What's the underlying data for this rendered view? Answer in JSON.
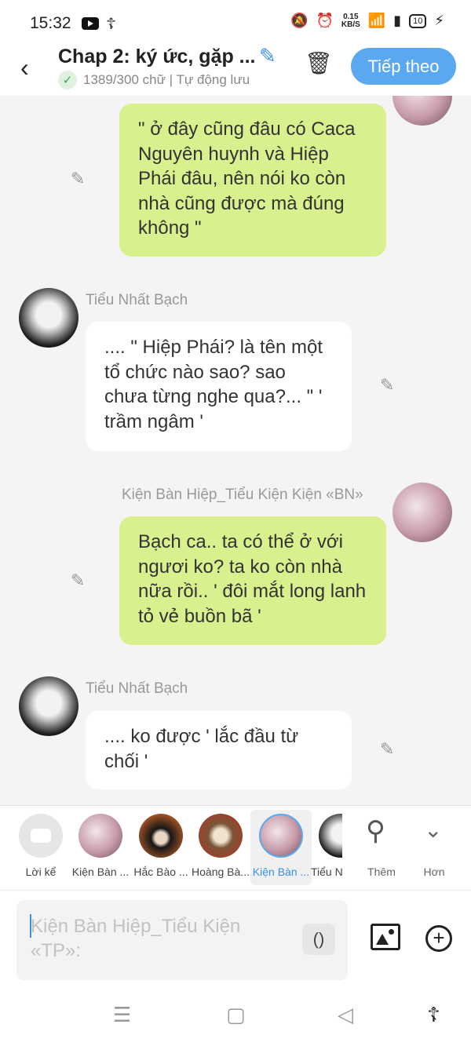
{
  "status": {
    "time": "15:32",
    "speed_value": "0.15",
    "speed_unit": "KB/S",
    "battery": "10"
  },
  "header": {
    "title": "Chap 2: ký ức, gặp ...",
    "word_count": "1389/300 chữ | Tự động lưu",
    "next_label": "Tiếp theo"
  },
  "messages": [
    {
      "side": "right",
      "text": "\" ở đây cũng đâu có Caca Nguyên huynh và Hiệp Phái đâu, nên nói ko còn nhà cũng được mà đúng không \""
    },
    {
      "side": "left",
      "sender": "Tiểu Nhất Bạch",
      "text": ".... \" Hiệp Phái? là tên một tổ chức nào sao? sao chưa từng nghe qua?... \" ' trầm ngâm '"
    },
    {
      "side": "right",
      "sender": "Kiện Bàn Hiệp_Tiểu Kiện Kiện «BN»",
      "text": "Bạch ca.. ta có thể ở với ngươi ko? ta ko còn nhà nữa rồi.. ' đôi mắt long lanh tỏ vẻ buồn bã '"
    },
    {
      "side": "left",
      "sender": "Tiểu Nhất Bạch",
      "text": ".... ko được ' lắc đầu từ chối '"
    }
  ],
  "characters": [
    {
      "label": "Lời kể"
    },
    {
      "label": "Kiện Bàn ..."
    },
    {
      "label": "Hắc Bào ..."
    },
    {
      "label": "Hoàng Bà..."
    },
    {
      "label": "Kiện Bàn ..."
    },
    {
      "label": "Tiểu N"
    }
  ],
  "char_actions": {
    "add_label": "Thêm",
    "more_label": "Hơn"
  },
  "input": {
    "placeholder": "Kiện Bàn Hiệp_Tiểu Kiện «TP»:",
    "paren_label": "()"
  },
  "icons": {
    "edit": "pencil-icon",
    "trash": "trash-icon",
    "image": "image-icon",
    "add": "plus-circle-icon"
  },
  "colors": {
    "accent": "#5aa9f0",
    "bubble_self": "#d8f08d",
    "bubble_other": "#ffffff"
  }
}
